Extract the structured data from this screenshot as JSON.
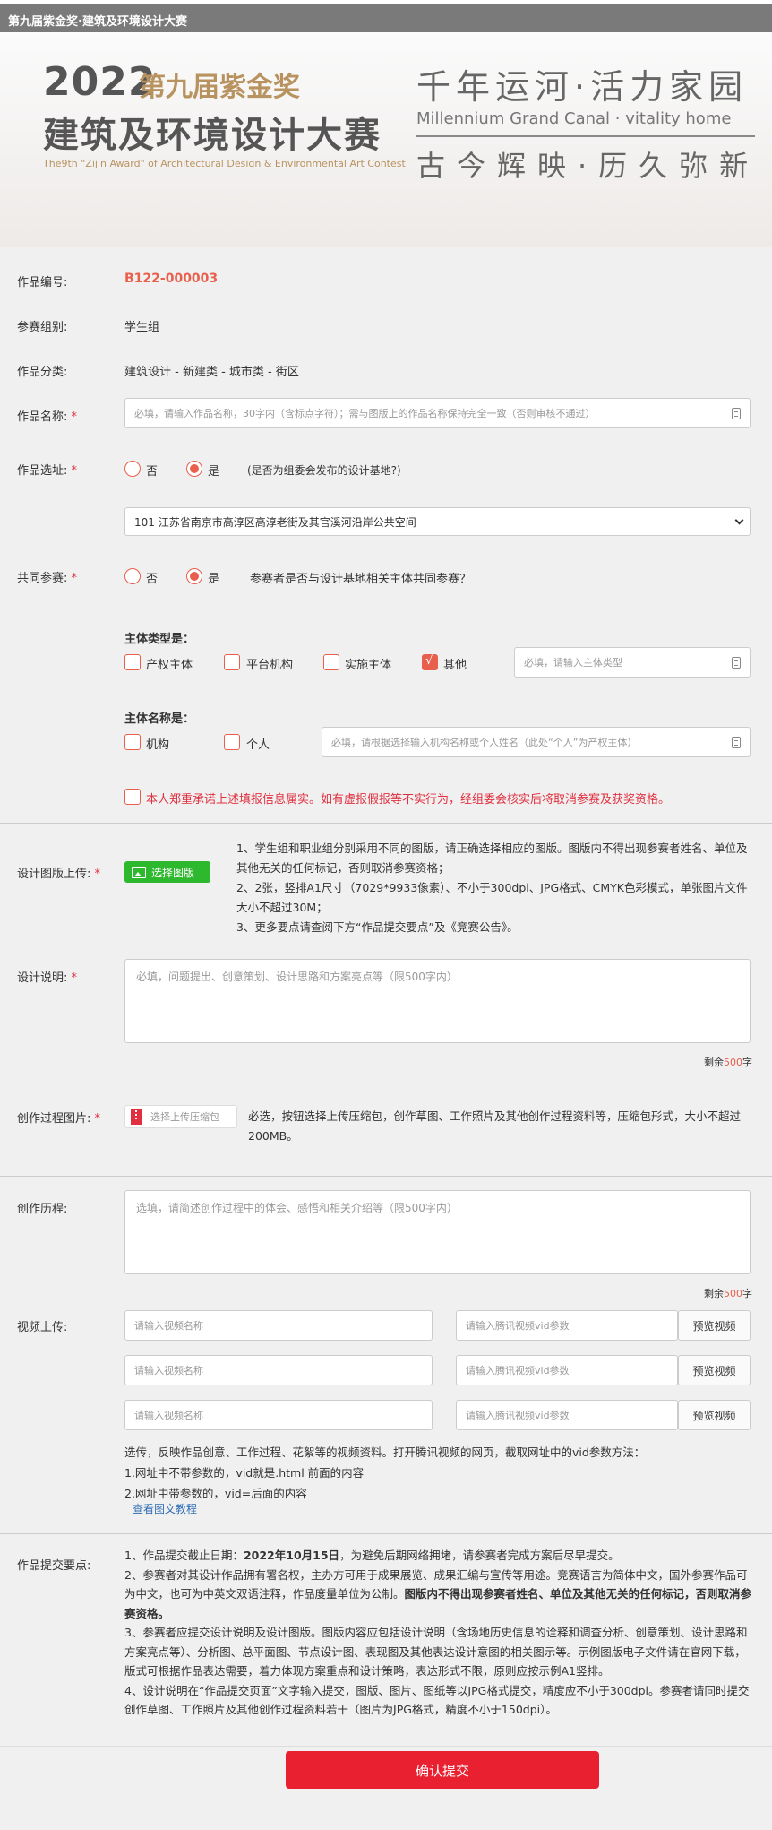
{
  "topbar": {
    "title": "第九届紫金奖·建筑及环境设计大赛"
  },
  "banner": {
    "year": "2022",
    "edition": "第九届紫金奖",
    "main_title": "建筑及环境设计大赛",
    "english_title": "The9th \"Zijin Award\" of Architectural Design & Environmental Art Contest",
    "slogan": "千年运河·活力家园",
    "slogan_en": "Millennium Grand Canal · vitality home",
    "slogan2": "古今辉映·历久弥新"
  },
  "form": {
    "work_no": {
      "label": "作品编号:",
      "value": "B122-000003"
    },
    "group": {
      "label": "参赛组别:",
      "value": "学生组"
    },
    "category": {
      "label": "作品分类:",
      "value": "建筑设计 - 新建类 - 城市类 - 街区"
    },
    "work_name": {
      "label": "作品名称:",
      "required": "*",
      "placeholder": "必填，请输入作品名称，30字内（含标点字符）；需与图版上的作品名称保持完全一致（否则审核不通过）"
    },
    "site": {
      "label": "作品选址:",
      "required": "*",
      "option_no": "否",
      "option_yes": "是",
      "hint": "(是否为组委会发布的设计基地?)",
      "selected_site": "101 江苏省南京市高淳区高淳老街及其官溪河沿岸公共空间"
    },
    "co_entry": {
      "label": "共同参赛:",
      "required": "*",
      "option_no": "否",
      "option_yes": "是",
      "hint": "参赛者是否与设计基地相关主体共同参赛？"
    },
    "entity_type": {
      "label": "主体类型是：",
      "options": [
        "产权主体",
        "平台机构",
        "实施主体",
        "其他"
      ],
      "checked_index": 3,
      "placeholder": "必填，请输入主体类型"
    },
    "entity_name": {
      "label": "主体名称是：",
      "options": [
        "机构",
        "个人"
      ],
      "placeholder": "必填，请根据选择输入机构名称或个人姓名（此处“个人”为产权主体）"
    },
    "pledge": "本人郑重承诺上述填报信息属实。如有虚报假报等不实行为，经组委会核实后将取消参赛及获奖资格。",
    "upload_board": {
      "label": "设计图版上传:",
      "required": "*",
      "button": "选择图版",
      "rules": [
        "1、学生组和职业组分别采用不同的图版，请正确选择相应的图版。图版内不得出现参赛者姓名、单位及其他无关的任何标记，否则取消参赛资格；",
        "2、2张，竖排A1尺寸（7029*9933像素）、不小于300dpi、JPG格式、CMYK色彩模式，单张图片文件大小不超过30M；",
        "3、更多要点请查阅下方“作品提交要点”及《竞赛公告》。"
      ]
    },
    "design_desc": {
      "label": "设计说明:",
      "required": "*",
      "placeholder": "必填，问题提出、创意策划、设计思路和方案亮点等（限500字内）",
      "remain_prefix": "剩余",
      "remain_count": "500",
      "remain_suffix": "字"
    },
    "process_images": {
      "label": "创作过程图片:",
      "required": "*",
      "button": "选择上传压缩包",
      "note": "必选，按钮选择上传压缩包，创作草图、工作照片及其他创作过程资料等，压缩包形式，大小不超过200MB。"
    },
    "process_history": {
      "label": "创作历程:",
      "placeholder": "选填，请简述创作过程中的体会、感悟和相关介绍等（限500字内）",
      "remain_prefix": "剩余",
      "remain_count": "500",
      "remain_suffix": "字"
    },
    "video": {
      "label": "视频上传:",
      "name_placeholder": "请输入视频名称",
      "vid_placeholder": "请输入腾讯视频vid参数",
      "preview_button": "预览视频",
      "notes": [
        "选传，反映作品创意、工作过程、花絮等的视频资料。打开腾讯视频的网页，截取网址中的vid参数方法：",
        "1.网址中不带参数的，vid就是.html 前面的内容",
        "2.网址中带参数的，vid=后面的内容"
      ],
      "tutorial_link": "查看图文教程"
    },
    "submission_points": {
      "label": "作品提交要点:",
      "p1_a": "1、作品提交截止日期：",
      "p1_b": "2022年10月15日",
      "p1_c": "，为避免后期网络拥堵，请参赛者完成方案后尽早提交。",
      "p2_a": "2、参赛者对其设计作品拥有署名权，主办方可用于成果展览、成果汇编与宣传等用途。竞赛语言为简体中文，国外参赛作品可为中文，也可为中英文双语注释，作品度量单位为公制。",
      "p2_b": "图版内不得出现参赛者姓名、单位及其他无关的任何标记，否则取消参赛资格。",
      "p3": "3、参赛者应提交设计说明及设计图版。图版内容应包括设计说明（含场地历史信息的诠释和调查分析、创意策划、设计思路和方案亮点等）、分析图、总平面图、节点设计图、表现图及其他表达设计意图的相关图示等。示例图版电子文件请在官网下载，版式可根据作品表达需要，着力体现方案重点和设计策略，表达形式不限，原则应按示例A1竖排。",
      "p4": "4、设计说明在“作品提交页面”文字输入提交，图版、图片、图纸等以JPG格式提交，精度应不小于300dpi。参赛者请同时提交创作草图、工作照片及其他创作过程资料若干（图片为JPG格式，精度不小于150dpi）。"
    },
    "submit_button": "确认提交"
  },
  "colors": {
    "accent": "#e8604c",
    "required": "#e03040",
    "green": "#2eb82e",
    "submit": "#e8202f"
  }
}
